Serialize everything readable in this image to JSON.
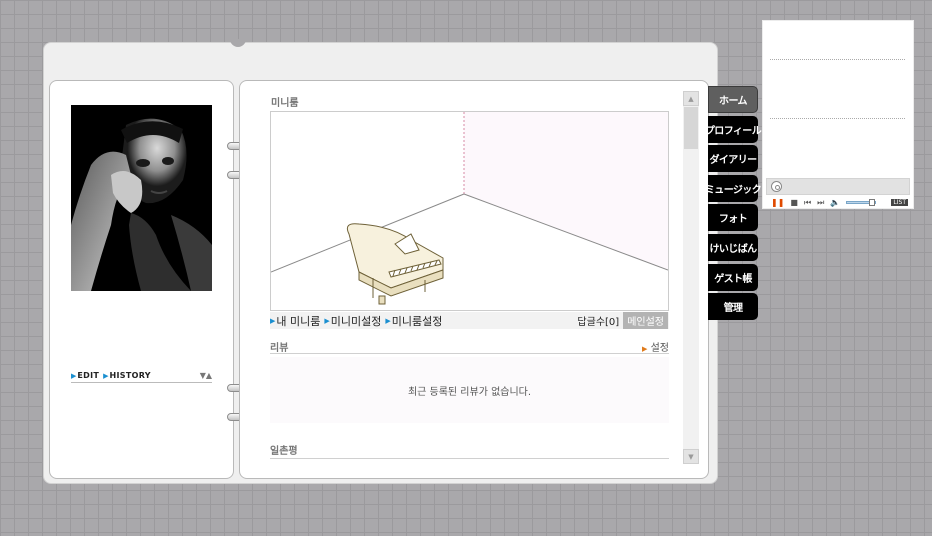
{
  "miniroom": {
    "title": "미니룸",
    "links": [
      "내 미니룸",
      "미니미설정",
      "미니룸설정"
    ],
    "reply_count_label": "답글수[0]",
    "main_setting_label": "메인설정"
  },
  "profile": {
    "edit_label": "EDIT",
    "history_label": "HISTORY"
  },
  "review": {
    "title": "리뷰",
    "setting_label": "설정",
    "empty_message": "최근 등록된 리뷰가 없습니다."
  },
  "ilchon": {
    "title": "일촌평"
  },
  "tabs": [
    {
      "label": "ホーム",
      "active": true
    },
    {
      "label": "プロフィール"
    },
    {
      "label": "ダイアリー"
    },
    {
      "label": "ミュージック"
    },
    {
      "label": "フォト"
    },
    {
      "label": "けいじばん"
    },
    {
      "label": "ゲスト帳"
    },
    {
      "label": "管理"
    }
  ],
  "player": {
    "list_label": "LIST",
    "icons": [
      "disc-icon",
      "pause-icon",
      "stop-icon",
      "prev-icon",
      "next-icon",
      "volume-icon"
    ]
  },
  "colors": {
    "background": "#a9a8ab",
    "tab_bg": "#000000",
    "tab_active_bg": "#5f5f5f",
    "accent_blue": "#1a8fd0",
    "accent_orange": "#e07a1a"
  }
}
